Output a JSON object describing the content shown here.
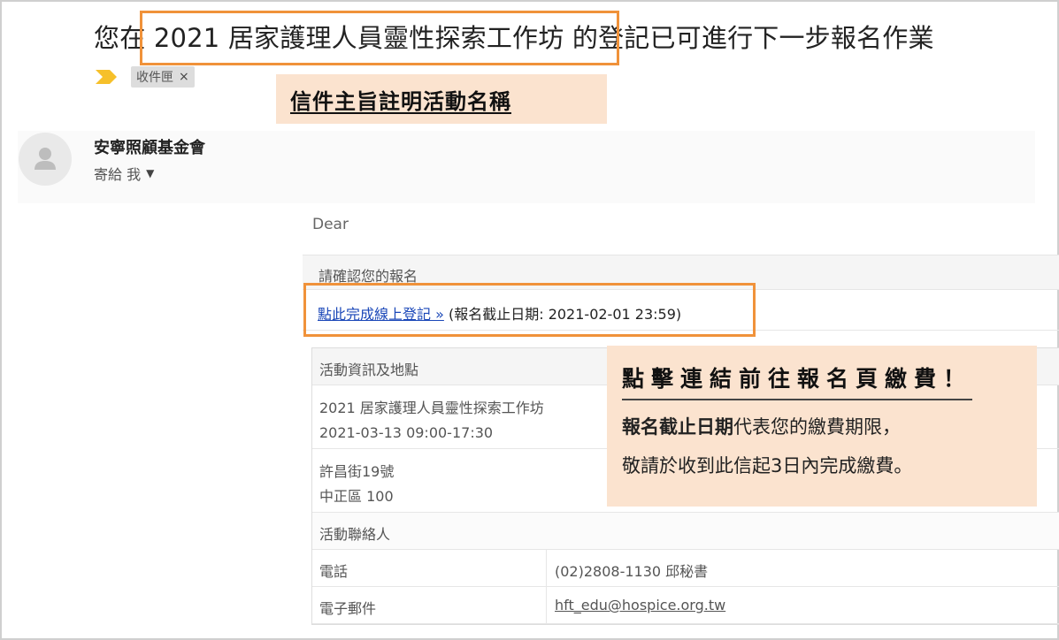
{
  "subject": {
    "prefix": "您在 ",
    "highlighted": "2021 居家護理人員靈性探索工作坊",
    "suffix": " 的登記已可進行下一步報名作業"
  },
  "labels": {
    "inbox_chip": "收件匣",
    "chip_close": "×"
  },
  "callout_subject": "信件主旨註明活動名稱",
  "sender": {
    "name": "安寧照顧基金會",
    "recipient": "寄給 我"
  },
  "body": {
    "greeting": "Dear",
    "confirm_header": "請確認您的報名",
    "register_link": "點此完成線上登記 »",
    "deadline": " (報名截止日期: 2021-02-01 23:59)"
  },
  "info_table": {
    "header": "活動資訊及地點",
    "event_name": "2021 居家護理人員靈性探索工作坊",
    "event_time": "2021-03-13 09:00-17:30",
    "address_line1": "許昌街19號",
    "address_line2": "中正區 100",
    "contact_header": "活動聯絡人",
    "phone_label": "電話",
    "phone_value": "(02)2808-1130 邱秘書",
    "email_label": "電子郵件",
    "email_value": "hft_edu@hospice.org.tw"
  },
  "callout_payment": {
    "title": "點擊連結前往報名頁繳費！",
    "deadline_term": "報名截止日期",
    "line2_rest": "代表您的繳費期限，",
    "line3": "敬請於收到此信起3日內完成繳費。"
  },
  "colors": {
    "highlight_border": "#f0923a",
    "callout_bg": "#fbe3cf",
    "link": "#1a47b8",
    "important_marker": "#f6c02a"
  }
}
